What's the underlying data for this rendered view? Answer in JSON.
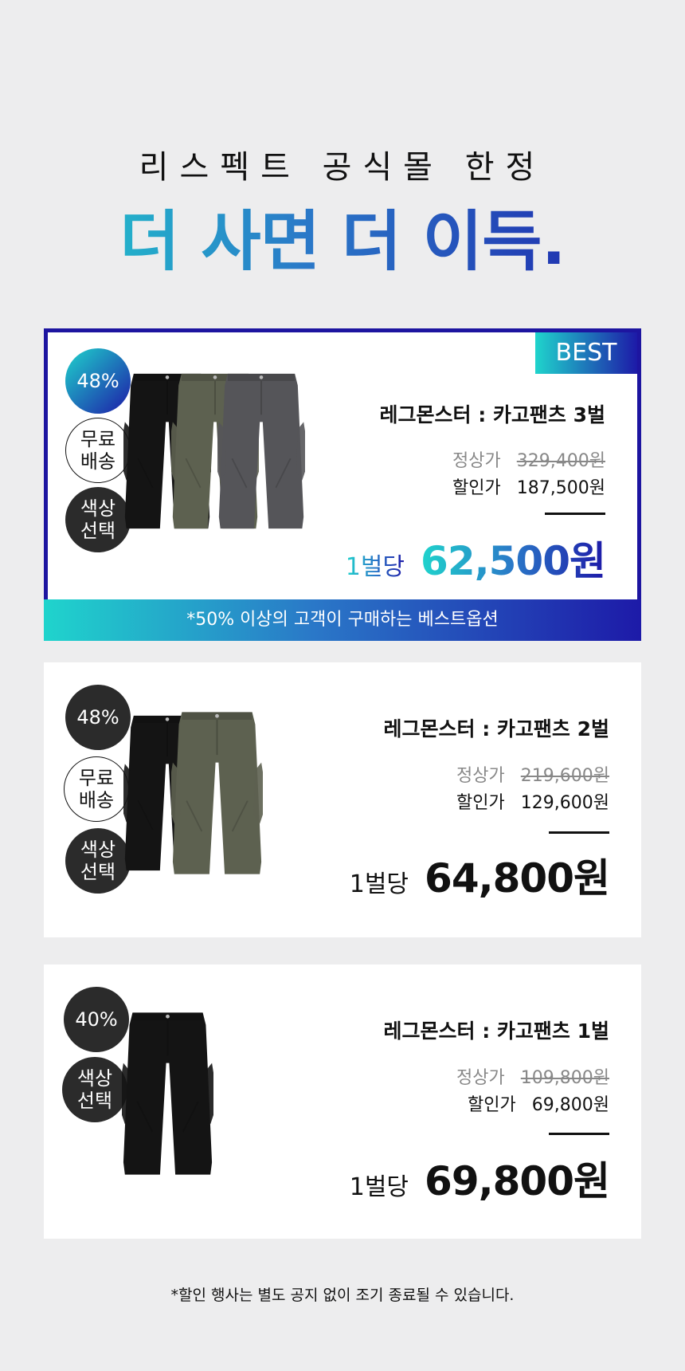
{
  "header": {
    "subtitle": "리스펙트 공식몰 한정",
    "headline": "더 사면 더 이득."
  },
  "colors": {
    "gradient_start": "#1fd4cc",
    "gradient_end": "#1d1aa8",
    "background": "#ededee",
    "badge_dark": "#2b2b2b"
  },
  "products": [
    {
      "best_badge": "BEST",
      "discount": "48%",
      "badge_free_shipping": "무료\n배송",
      "badge_color_select": "색상\n선택",
      "name": "레그몬스터 : 카고팬츠 3벌",
      "regular_label": "정상가",
      "regular_price": "329,400원",
      "sale_label": "할인가",
      "sale_price": "187,500원",
      "per_unit_label": "1벌당",
      "per_unit_price": "62,500원",
      "banner": "*50% 이상의 고객이 구매하는 베스트옵션",
      "image_colors": [
        "#141414",
        "#5d6150",
        "#555559"
      ]
    },
    {
      "discount": "48%",
      "badge_free_shipping": "무료\n배송",
      "badge_color_select": "색상\n선택",
      "name": "레그몬스터 : 카고팬츠 2벌",
      "regular_label": "정상가",
      "regular_price": "219,600원",
      "sale_label": "할인가",
      "sale_price": "129,600원",
      "per_unit_label": "1벌당",
      "per_unit_price": "64,800원",
      "image_colors": [
        "#141414",
        "#5d6150"
      ]
    },
    {
      "discount": "40%",
      "badge_color_select": "색상\n선택",
      "name": "레그몬스터 : 카고팬츠 1벌",
      "regular_label": "정상가",
      "regular_price": "109,800원",
      "sale_label": "할인가",
      "sale_price": "69,800원",
      "per_unit_label": "1벌당",
      "per_unit_price": "69,800원",
      "image_colors": [
        "#141414"
      ]
    }
  ],
  "footer": {
    "note": "*할인 행사는 별도 공지 없이 조기 종료될 수 있습니다."
  }
}
